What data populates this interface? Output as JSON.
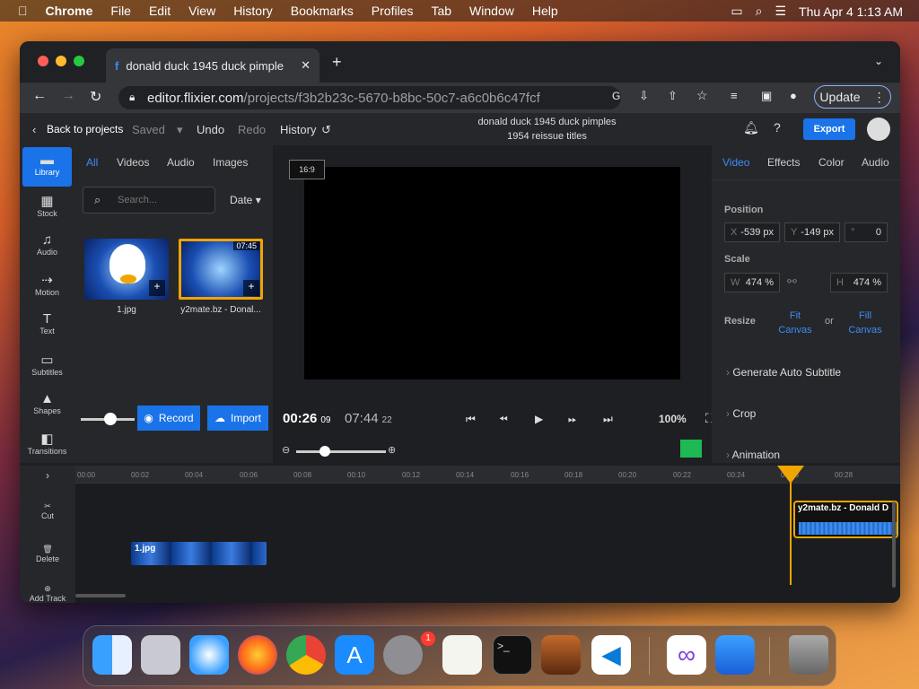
{
  "menubar": {
    "app": "Chrome",
    "items": [
      "File",
      "Edit",
      "View",
      "History",
      "Bookmarks",
      "Profiles",
      "Tab",
      "Window",
      "Help"
    ],
    "clock": "Thu Apr 4  1:13 AM"
  },
  "browser": {
    "tab_title": "donald duck 1945 duck pimple",
    "url_host": "editor.flixier.com",
    "url_path": "/projects/f3b2b23c-5670-b8bc-50c7-a6c0b6c47fcf",
    "update_label": "Update"
  },
  "header": {
    "back": "Back to projects",
    "saved": "Saved",
    "undo": "Undo",
    "redo": "Redo",
    "history": "History",
    "title_line1": "donald duck 1945 duck pimples",
    "title_line2": "1954 reissue titles",
    "export": "Export"
  },
  "rail": [
    {
      "label": "Library",
      "icon": "folder-icon"
    },
    {
      "label": "Stock",
      "icon": "film-icon"
    },
    {
      "label": "Audio",
      "icon": "music-icon"
    },
    {
      "label": "Motion",
      "icon": "motion-icon"
    },
    {
      "label": "Text",
      "icon": "text-icon"
    },
    {
      "label": "Subtitles",
      "icon": "subtitles-icon"
    },
    {
      "label": "Shapes",
      "icon": "shapes-icon"
    },
    {
      "label": "Transitions",
      "icon": "transitions-icon"
    }
  ],
  "library": {
    "tabs": [
      "All",
      "Videos",
      "Audio",
      "Images"
    ],
    "search_placeholder": "Search...",
    "sort": "Date",
    "items": [
      {
        "name": "1.jpg"
      },
      {
        "name": "y2mate.bz - Donal...",
        "duration": "07:45"
      }
    ],
    "record": "Record",
    "import": "Import"
  },
  "preview": {
    "ratio": "16:9",
    "current": "00:26",
    "current_frames": "09",
    "total": "07:44",
    "total_frames": "22",
    "zoom": "100%"
  },
  "props": {
    "tabs": [
      "Video",
      "Effects",
      "Color",
      "Audio"
    ],
    "position_label": "Position",
    "x_key": "X",
    "x": "-539 px",
    "y_key": "Y",
    "y": "-149 px",
    "rot_key": "°",
    "rot": "0",
    "scale_label": "Scale",
    "w_key": "W",
    "w": "474 %",
    "h_key": "H",
    "h": "474 %",
    "resize_label": "Resize",
    "fit": "Fit\nCanvas",
    "or": "or",
    "fill": "Fill\nCanvas",
    "sections": [
      "Generate Auto Subtitle",
      "Crop",
      "Animation"
    ]
  },
  "timeline": {
    "ticks": [
      "00:00",
      "00:02",
      "00:04",
      "00:06",
      "00:08",
      "00:10",
      "00:12",
      "00:14",
      "00:16",
      "00:18",
      "00:20",
      "00:22",
      "00:24",
      "00:26",
      "00:28"
    ],
    "tools": [
      "Cut",
      "Delete",
      "Add Track"
    ],
    "clip1": "1.jpg",
    "clip2": "y2mate.bz - Donald D"
  }
}
